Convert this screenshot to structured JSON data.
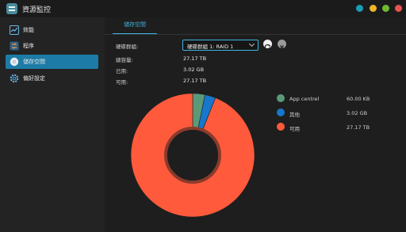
{
  "window": {
    "title": "資源監控",
    "controls": [
      {
        "name": "teal-window-button",
        "color": "#1a9db5"
      },
      {
        "name": "minimize-button",
        "color": "#f0b429"
      },
      {
        "name": "maximize-button",
        "color": "#6dbb2f"
      },
      {
        "name": "close-button",
        "color": "#e8534f"
      }
    ]
  },
  "sidebar": {
    "items": [
      {
        "label": "效能",
        "icon": "performance-chart-icon",
        "active": false
      },
      {
        "label": "程序",
        "icon": "process-icon",
        "active": false
      },
      {
        "label": "儲存空間",
        "icon": "storage-disk-icon",
        "active": true
      },
      {
        "label": "偏好設定",
        "icon": "gear-icon",
        "active": false
      }
    ]
  },
  "main": {
    "tab": "儲存空間",
    "disk_group_label": "硬碟群組:",
    "disk_group_selected": "硬碟群組 1: RAID 1",
    "stats": [
      {
        "label": "總容量:",
        "value": "27.17 TB"
      },
      {
        "label": "已用:",
        "value": "3.02 GB"
      },
      {
        "label": "可用:",
        "value": "27.17 TB"
      }
    ]
  },
  "chart_data": {
    "type": "pie",
    "slices": [
      {
        "name": "App centrel",
        "value_label": "60.00 KB",
        "fraction": 0.032,
        "color": "#5b9a79"
      },
      {
        "name": "其他",
        "value_label": "3.02 GB",
        "fraction": 0.028,
        "color": "#1777cc"
      },
      {
        "name": "可用",
        "value_label": "27.17 TB",
        "fraction": 0.94,
        "color": "#ff5a3c"
      }
    ]
  }
}
